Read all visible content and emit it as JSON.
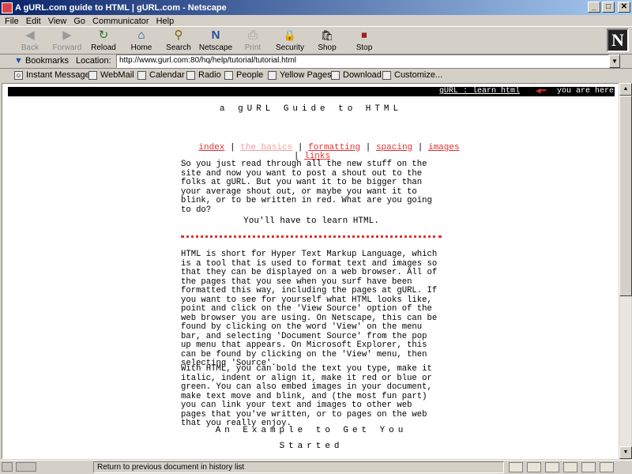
{
  "window": {
    "title": "A gURL.com guide to HTML | gURL.com - Netscape",
    "minimize": "_",
    "maximize": "□",
    "close": "✕"
  },
  "menu": [
    "File",
    "Edit",
    "View",
    "Go",
    "Communicator",
    "Help"
  ],
  "toolbar": [
    {
      "label": "Back",
      "icon": "◀",
      "enabled": false
    },
    {
      "label": "Forward",
      "icon": "▶",
      "enabled": false
    },
    {
      "label": "Reload",
      "icon": "↻",
      "enabled": true
    },
    {
      "label": "Home",
      "icon": "⌂",
      "enabled": true
    },
    {
      "label": "Search",
      "icon": "⚲",
      "enabled": true
    },
    {
      "label": "Netscape",
      "icon": "N",
      "enabled": true
    },
    {
      "label": "Print",
      "icon": "⎙",
      "enabled": false
    },
    {
      "label": "Security",
      "icon": "🔒",
      "enabled": true
    },
    {
      "label": "Shop",
      "icon": "🛍",
      "enabled": true
    },
    {
      "label": "Stop",
      "icon": "⏹",
      "enabled": true
    }
  ],
  "logo": "N",
  "location": {
    "bookmarks_label": "Bookmarks",
    "label": "Location:",
    "url": "http://www.gurl.com:80/hq/help/tutorial/tutorial.html"
  },
  "personal_toolbar": [
    "Instant Message",
    "WebMail",
    "Calendar",
    "Radio",
    "People",
    "Yellow Pages",
    "Download",
    "Customize..."
  ],
  "page": {
    "top_strip": {
      "nav": "gURL : learn html",
      "here": "you are here"
    },
    "title": "a gURL Guide to HTML",
    "nav_links": [
      {
        "label": "index",
        "visited": false
      },
      {
        "label": "the basics",
        "visited": true
      },
      {
        "label": "formatting",
        "visited": false
      },
      {
        "label": "spacing",
        "visited": false
      },
      {
        "label": "images",
        "visited": false
      },
      {
        "label": "links",
        "visited": false
      }
    ],
    "separator": "|",
    "intro": "So you just read through all the new stuff on the\nsite and now you want to post a shout out to the\nfolks at gURL. But you want it to be bigger than\nyour average shout out, or maybe you want it to\nblink, or to be written in red. What are you going\nto do?",
    "learn": "You'll have to learn HTML.",
    "para1": "HTML is short for Hyper Text Markup Language, which\nis a tool that is used to format text and images so\nthat they can be displayed on a web browser. All of\nthe pages that you see when you surf have been\nformatted this way, including the pages at gURL. If\nyou want to see for yourself what HTML looks like,\npoint and click on the 'View Source' option of the\nweb browser you are using. On Netscape, this can be\nfound by clicking on the word 'View' on the menu\nbar, and selecting 'Document Source' from the pop\nup menu that appears. On Microsoft Explorer, this\ncan be found by clicking on the 'View' menu, then\nselecting 'Source'.",
    "para2": "With HTML, you can bold the text you type, make it\nitalic, indent or align it, make it red or blue or\ngreen. You can also embed images in your document,\nmake text move and blink, and (the most fun part)\nyou can link your text and images to other web\npages that you've written, or to pages on the web\nthat you really enjoy.",
    "example_line1": "An Example to Get You",
    "example_line2": "Started"
  },
  "status": {
    "text": "Return to previous document in history list"
  },
  "colors": {
    "link": "#e03030",
    "visited": "#f0a0a0",
    "title_bar": "#0a246a"
  }
}
